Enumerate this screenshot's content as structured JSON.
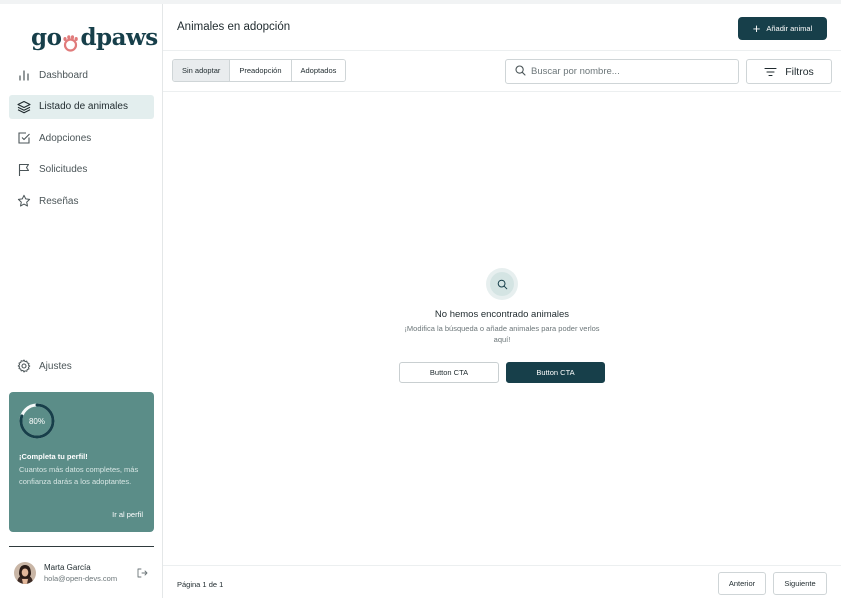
{
  "brand": {
    "logo_text_left": "go",
    "logo_text_right": "dpaws",
    "primary": "#173f4a",
    "card": "#5b8d88",
    "paw_color": "#e07b7b"
  },
  "sidebar": {
    "items": [
      {
        "label": "Dashboard",
        "icon": "bar-chart-icon"
      },
      {
        "label": "Listado de animales",
        "icon": "layers-icon",
        "active": true
      },
      {
        "label": "Adopciones",
        "icon": "checkbox-icon"
      },
      {
        "label": "Solicitudes",
        "icon": "flag-icon"
      },
      {
        "label": "Reseñas",
        "icon": "star-icon"
      }
    ],
    "settings_label": "Ajustes",
    "profile_card": {
      "progress_percent": 80,
      "progress_label": "80%",
      "title": "¡Completa tu perfil!",
      "body": "Cuantos más datos completes, más confianza darás a los adoptantes.",
      "link": "Ir al perfil"
    },
    "user": {
      "name": "Marta García",
      "email": "hola@open-devs.com"
    }
  },
  "header": {
    "title": "Animales en adopción",
    "add_button": "Añadir animal"
  },
  "toolbar": {
    "tabs": [
      {
        "label": "Sin adoptar",
        "active": true
      },
      {
        "label": "Preadopción"
      },
      {
        "label": "Adoptados"
      }
    ],
    "search_placeholder": "Buscar por nombre...",
    "filter_label": "Filtros"
  },
  "empty_state": {
    "title": "No hemos encontrado animales",
    "subtitle": "¡Modifica la búsqueda o añade animales para poder verlos aquí!",
    "secondary_cta": "Button CTA",
    "primary_cta": "Button CTA"
  },
  "footer": {
    "page_info": "Página 1 de 1",
    "prev": "Anterior",
    "next": "Siguiente"
  }
}
